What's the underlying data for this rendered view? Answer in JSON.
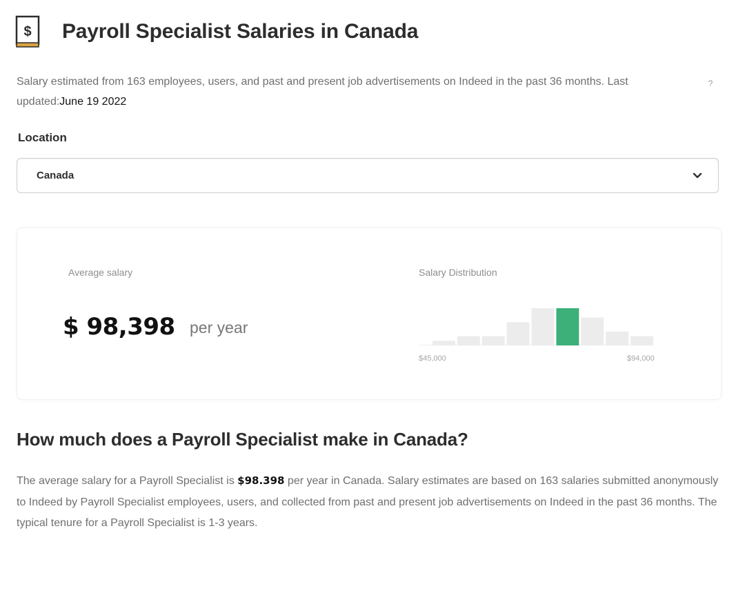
{
  "header": {
    "title": "Payroll Specialist Salaries in Canada",
    "icon": "money-bill-icon"
  },
  "description": {
    "text": "Salary estimated from 163 employees, users, and past and present job advertisements on Indeed in the past 36 months. Last updated:",
    "updated_date": "June 19 2022",
    "help_label": "?"
  },
  "location": {
    "label": "Location",
    "selected": "Canada"
  },
  "salary_card": {
    "average_label": "Average salary",
    "amount": "$ 98,398",
    "period": "per year",
    "distribution_label": "Salary Distribution",
    "distribution_min": "$45,000",
    "distribution_max": "$94,000",
    "distribution_bins": [
      1,
      2,
      2,
      5,
      8,
      8,
      6,
      3,
      2
    ],
    "highlight_bin": 5,
    "highlight_color": "#3db07a",
    "bin_color": "#ececec"
  },
  "section": {
    "heading": "How much does a Payroll Specialist make in Canada?",
    "body_prefix": "The average salary for a Payroll Specialist is ",
    "body_salary": "$98.398",
    "body_suffix": " per year in Canada. Salary estimates are based on 163 salaries submitted anonymously to Indeed by Payroll Specialist employees, users, and collected from past and present job advertisements on Indeed in the past 36 months. The typical tenure for a Payroll Specialist is 1-3 years."
  }
}
